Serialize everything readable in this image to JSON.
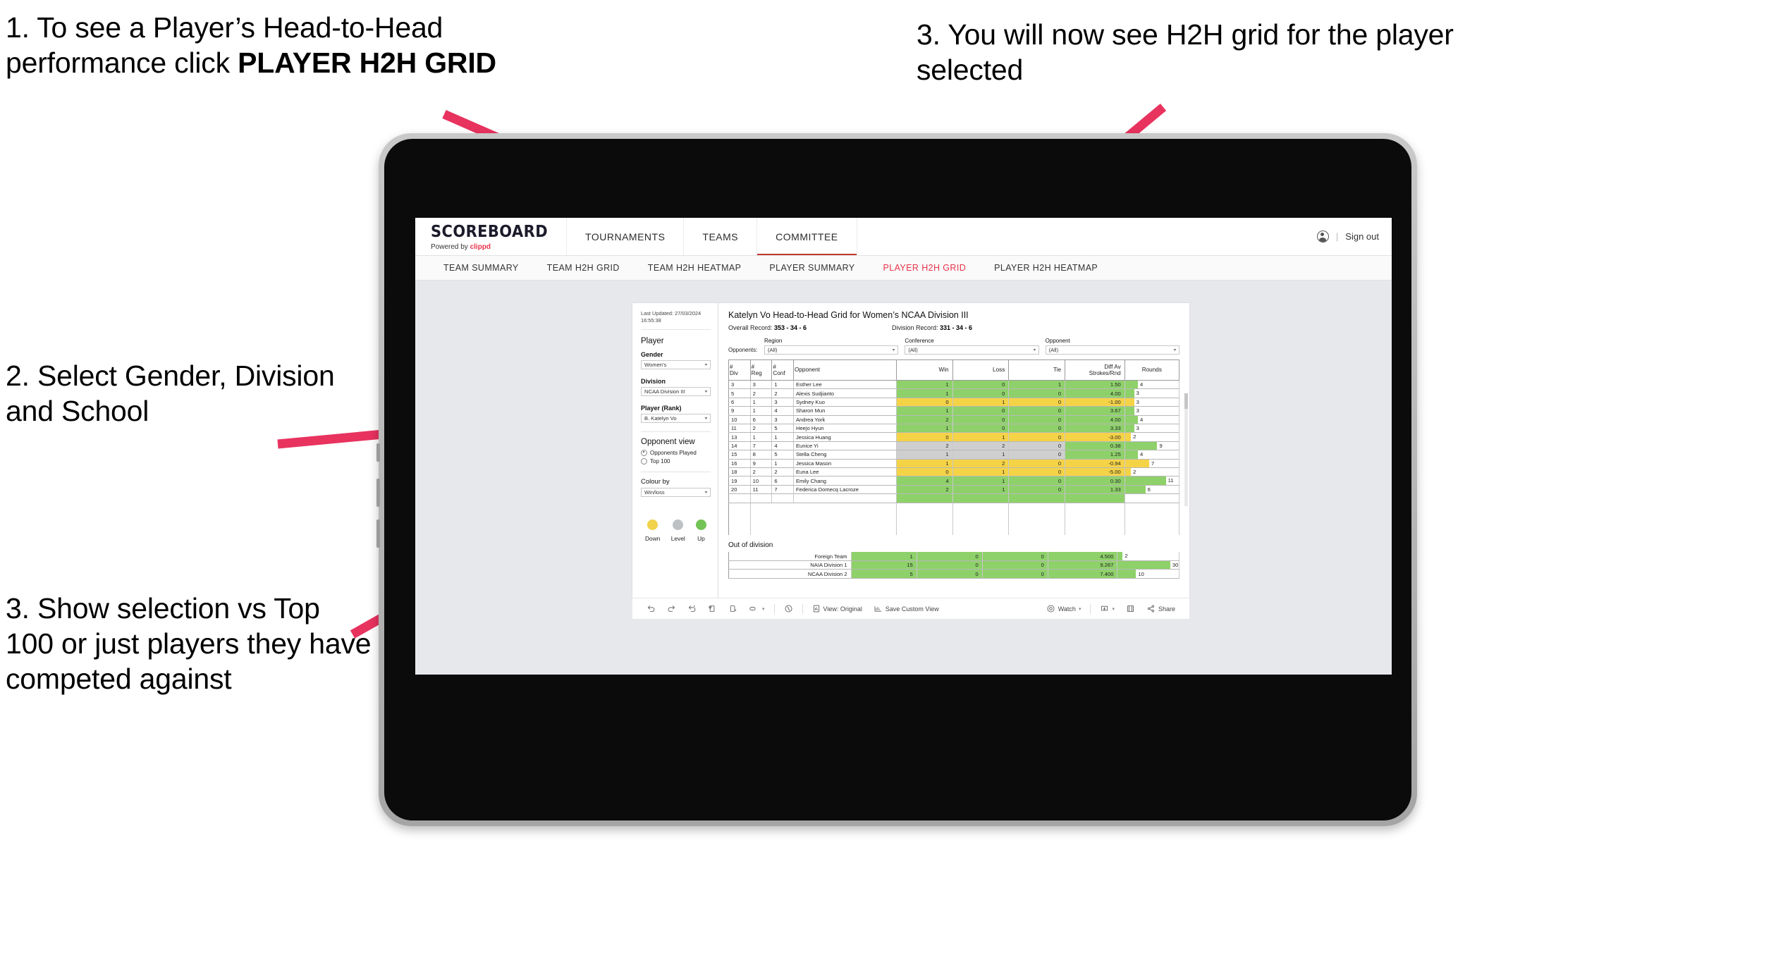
{
  "annotations": [
    {
      "id": "a1",
      "text": "1. To see a Player’s Head-to-Head performance click ",
      "bold": "PLAYER H2H GRID"
    },
    {
      "id": "a2",
      "text": "2. Select Gender, Division and School"
    },
    {
      "id": "a3",
      "text": "3. Show selection vs Top 100 or just players they have competed against"
    },
    {
      "id": "a4",
      "text": "3. You will now see H2H grid for the player selected"
    }
  ],
  "colors": {
    "accent_pink": "#e8335f",
    "brand_red": "#e8334a",
    "up_green": "#8ed16a",
    "down_yellow": "#f5d347",
    "level_grey": "#cfcfcf",
    "canvas": "#e6e8ec"
  },
  "topbar": {
    "brand_name": "SCOREBOARD",
    "brand_sub_prefix": "Powered by ",
    "brand_sub_link": "clippd",
    "nav": [
      {
        "label": "TOURNAMENTS",
        "active": false
      },
      {
        "label": "TEAMS",
        "active": false
      },
      {
        "label": "COMMITTEE",
        "active": true
      }
    ],
    "separator": "|",
    "sign_out": "Sign out",
    "user_icon": "user-icon"
  },
  "subnav": {
    "items": [
      {
        "label": "TEAM SUMMARY",
        "active": false
      },
      {
        "label": "TEAM H2H GRID",
        "active": false
      },
      {
        "label": "TEAM H2H HEATMAP",
        "active": false
      },
      {
        "label": "PLAYER SUMMARY",
        "active": false
      },
      {
        "label": "PLAYER H2H GRID",
        "active": true
      },
      {
        "label": "PLAYER H2H HEATMAP",
        "active": false
      }
    ]
  },
  "sidebar": {
    "last_updated": "Last Updated: 27/03/2024 16:55:38",
    "player_heading": "Player",
    "fields": [
      {
        "label": "Gender",
        "value": "Women's"
      },
      {
        "label": "Division",
        "value": "NCAA Division III"
      },
      {
        "label": "Player (Rank)",
        "value": "B. Katelyn Vo"
      }
    ],
    "opponent_view_heading": "Opponent view",
    "opponent_view_options": [
      {
        "label": "Opponents Played",
        "selected": true
      },
      {
        "label": "Top 100",
        "selected": false
      }
    ],
    "colour_by_label": "Colour by",
    "colour_by_value": "Win/loss",
    "legend": [
      {
        "label": "Down",
        "color": "#f0d24b"
      },
      {
        "label": "Level",
        "color": "#bdc1c4"
      },
      {
        "label": "Up",
        "color": "#74c356"
      }
    ]
  },
  "viz": {
    "title": "Katelyn Vo Head-to-Head Grid for Women’s NCAA Division III",
    "overall_record_label": "Overall Record: ",
    "overall_record_value": "353 -  34 - 6",
    "division_record_label": "Division Record: ",
    "division_record_value": "331 -  34 - 6",
    "opponents_label": "Opponents:",
    "filters": [
      {
        "label": "Region",
        "value": "(All)"
      },
      {
        "label": "Conference",
        "value": "(All)"
      },
      {
        "label": "Opponent",
        "value": "(All)"
      }
    ],
    "columns": [
      "# Div",
      "# Reg",
      "# Conf",
      "Opponent",
      "Win",
      "Loss",
      "Tie",
      "Diff Av Strokes/Rnd",
      "Rounds"
    ],
    "column_lines": [
      [
        "#",
        "Div"
      ],
      [
        "#",
        "Reg"
      ],
      [
        "#",
        "Conf"
      ],
      [
        "Opponent",
        ""
      ],
      [
        "Win",
        ""
      ],
      [
        "Loss",
        ""
      ],
      [
        "Tie",
        ""
      ],
      [
        "Diff Av",
        "Strokes/Rnd"
      ],
      [
        "Rounds",
        ""
      ]
    ],
    "rows": [
      {
        "div": "3",
        "reg": "3",
        "conf": "1",
        "opponent": "Esther Lee",
        "win": "1",
        "loss": "0",
        "tie": "1",
        "diff": "1.50",
        "rounds": "4",
        "state": "up",
        "bar": 24
      },
      {
        "div": "5",
        "reg": "2",
        "conf": "2",
        "opponent": "Alexis Sudjianto",
        "win": "1",
        "loss": "0",
        "tie": "0",
        "diff": "4.00",
        "rounds": "3",
        "state": "up",
        "bar": 17
      },
      {
        "div": "6",
        "reg": "1",
        "conf": "3",
        "opponent": "Sydney Kuo",
        "win": "0",
        "loss": "1",
        "tie": "0",
        "diff": "-1.00",
        "rounds": "3",
        "state": "down",
        "bar": 17
      },
      {
        "div": "9",
        "reg": "1",
        "conf": "4",
        "opponent": "Sharon Mun",
        "win": "1",
        "loss": "0",
        "tie": "0",
        "diff": "3.67",
        "rounds": "3",
        "state": "up",
        "bar": 17
      },
      {
        "div": "10",
        "reg": "6",
        "conf": "3",
        "opponent": "Andrea York",
        "win": "2",
        "loss": "0",
        "tie": "0",
        "diff": "4.00",
        "rounds": "4",
        "state": "up",
        "bar": 24
      },
      {
        "div": "11",
        "reg": "2",
        "conf": "5",
        "opponent": "Heejo Hyun",
        "win": "1",
        "loss": "0",
        "tie": "0",
        "diff": "3.33",
        "rounds": "3",
        "state": "up",
        "bar": 17
      },
      {
        "div": "13",
        "reg": "1",
        "conf": "1",
        "opponent": "Jessica Huang",
        "win": "0",
        "loss": "1",
        "tie": "0",
        "diff": "-3.00",
        "rounds": "2",
        "state": "down",
        "bar": 11
      },
      {
        "div": "14",
        "reg": "7",
        "conf": "4",
        "opponent": "Eunice Yi",
        "win": "2",
        "loss": "2",
        "tie": "0",
        "diff": "0.38",
        "rounds": "9",
        "state": "level",
        "bar": 60,
        "diff_state": "up"
      },
      {
        "div": "15",
        "reg": "8",
        "conf": "5",
        "opponent": "Stella Cheng",
        "win": "1",
        "loss": "1",
        "tie": "0",
        "diff": "1.25",
        "rounds": "4",
        "state": "level",
        "bar": 24,
        "diff_state": "up"
      },
      {
        "div": "16",
        "reg": "9",
        "conf": "1",
        "opponent": "Jessica Mason",
        "win": "1",
        "loss": "2",
        "tie": "0",
        "diff": "-0.94",
        "rounds": "7",
        "state": "down",
        "bar": 45
      },
      {
        "div": "18",
        "reg": "2",
        "conf": "2",
        "opponent": "Euna Lee",
        "win": "0",
        "loss": "1",
        "tie": "0",
        "diff": "-5.00",
        "rounds": "2",
        "state": "down",
        "bar": 11
      },
      {
        "div": "19",
        "reg": "10",
        "conf": "6",
        "opponent": "Emily Chang",
        "win": "4",
        "loss": "1",
        "tie": "0",
        "diff": "0.30",
        "rounds": "11",
        "state": "up",
        "bar": 76
      },
      {
        "div": "20",
        "reg": "11",
        "conf": "7",
        "opponent": "Federica Domecq Lacroze",
        "win": "2",
        "loss": "1",
        "tie": "0",
        "diff": "1.33",
        "rounds": "6",
        "state": "up",
        "bar": 38
      }
    ],
    "out_of_division_title": "Out of division",
    "out_of_division_rows": [
      {
        "name": "Foreign Team",
        "win": "1",
        "loss": "0",
        "tie": "0",
        "diff": "4.500",
        "rounds": "2",
        "state": "up",
        "bar": 8
      },
      {
        "name": "NAIA Division 1",
        "win": "15",
        "loss": "0",
        "tie": "0",
        "diff": "9.267",
        "rounds": "30",
        "state": "up",
        "bar": 86
      },
      {
        "name": "NCAA Division 2",
        "win": "5",
        "loss": "0",
        "tie": "0",
        "diff": "7.400",
        "rounds": "10",
        "state": "up",
        "bar": 30
      }
    ]
  },
  "toolbar": {
    "items": [
      {
        "name": "undo-icon",
        "label": ""
      },
      {
        "name": "redo-icon",
        "label": ""
      },
      {
        "name": "revert-icon",
        "label": ""
      },
      {
        "name": "refresh-data-icon",
        "label": ""
      },
      {
        "name": "pause-updates-icon",
        "label": ""
      },
      {
        "name": "highlight-icon",
        "label": ""
      },
      {
        "name": "reset-filters-icon",
        "label": ""
      },
      {
        "name": "view-original-icon",
        "label": "View: Original"
      },
      {
        "name": "save-custom-view-icon",
        "label": "Save Custom View"
      },
      {
        "name": "watch-icon",
        "label": "Watch"
      },
      {
        "name": "download-icon",
        "label": ""
      },
      {
        "name": "fullscreen-icon",
        "label": ""
      },
      {
        "name": "share-icon",
        "label": "Share"
      }
    ],
    "view_original": "View: Original",
    "save_custom_view": "Save Custom View",
    "watch": "Watch",
    "share": "Share"
  }
}
